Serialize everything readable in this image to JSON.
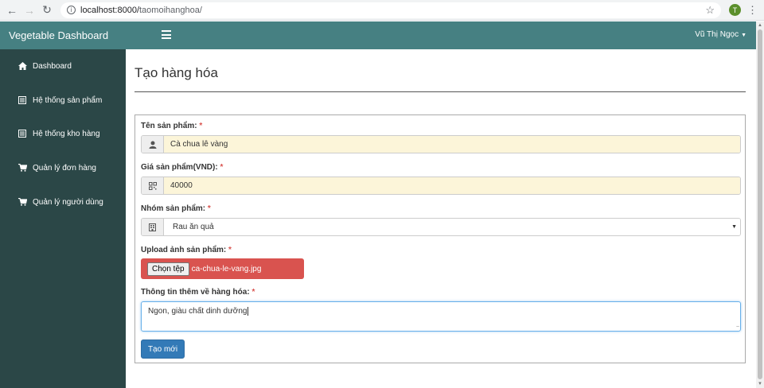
{
  "browser": {
    "url_host": "localhost:8000/",
    "url_path": "taomoihanghoa/",
    "profile_initial": "T"
  },
  "navbar": {
    "brand": "Vegetable Dashboard",
    "user_name": "Vũ Thị Ngọc"
  },
  "sidebar": {
    "items": [
      {
        "label": "Dashboard",
        "icon": "home-icon"
      },
      {
        "label": "Hệ thống sản phẩm",
        "icon": "list-icon"
      },
      {
        "label": "Hệ thống kho hàng",
        "icon": "list-icon"
      },
      {
        "label": "Quản lý đơn hàng",
        "icon": "cart-icon"
      },
      {
        "label": "Quản lý người dùng",
        "icon": "cart-icon"
      }
    ]
  },
  "page": {
    "title": "Tạo hàng hóa"
  },
  "form": {
    "required_mark": "*",
    "name": {
      "label": "Tên sản phẩm:",
      "value": "Cà chua lê vàng",
      "icon": "user-icon"
    },
    "price": {
      "label": "Giá sản phẩm(VND):",
      "value": "40000",
      "icon": "qrcode-icon"
    },
    "group": {
      "label": "Nhóm sản phẩm:",
      "value": "Rau ăn quả",
      "icon": "building-icon"
    },
    "upload": {
      "label": "Upload ảnh sản phẩm:",
      "button": "Chọn tệp",
      "file_name": "ca-chua-le-vang.jpg"
    },
    "info": {
      "label": "Thông tin thêm về hàng hóa:",
      "value": "Ngon, giàu chất dinh dưỡng"
    },
    "submit": "Tạo mới"
  },
  "colors": {
    "navbar": "#468082",
    "sidebar": "#2b4747",
    "input_fill": "#fcf5d9",
    "upload_bg": "#d9534f",
    "submit_bg": "#337ab7"
  }
}
